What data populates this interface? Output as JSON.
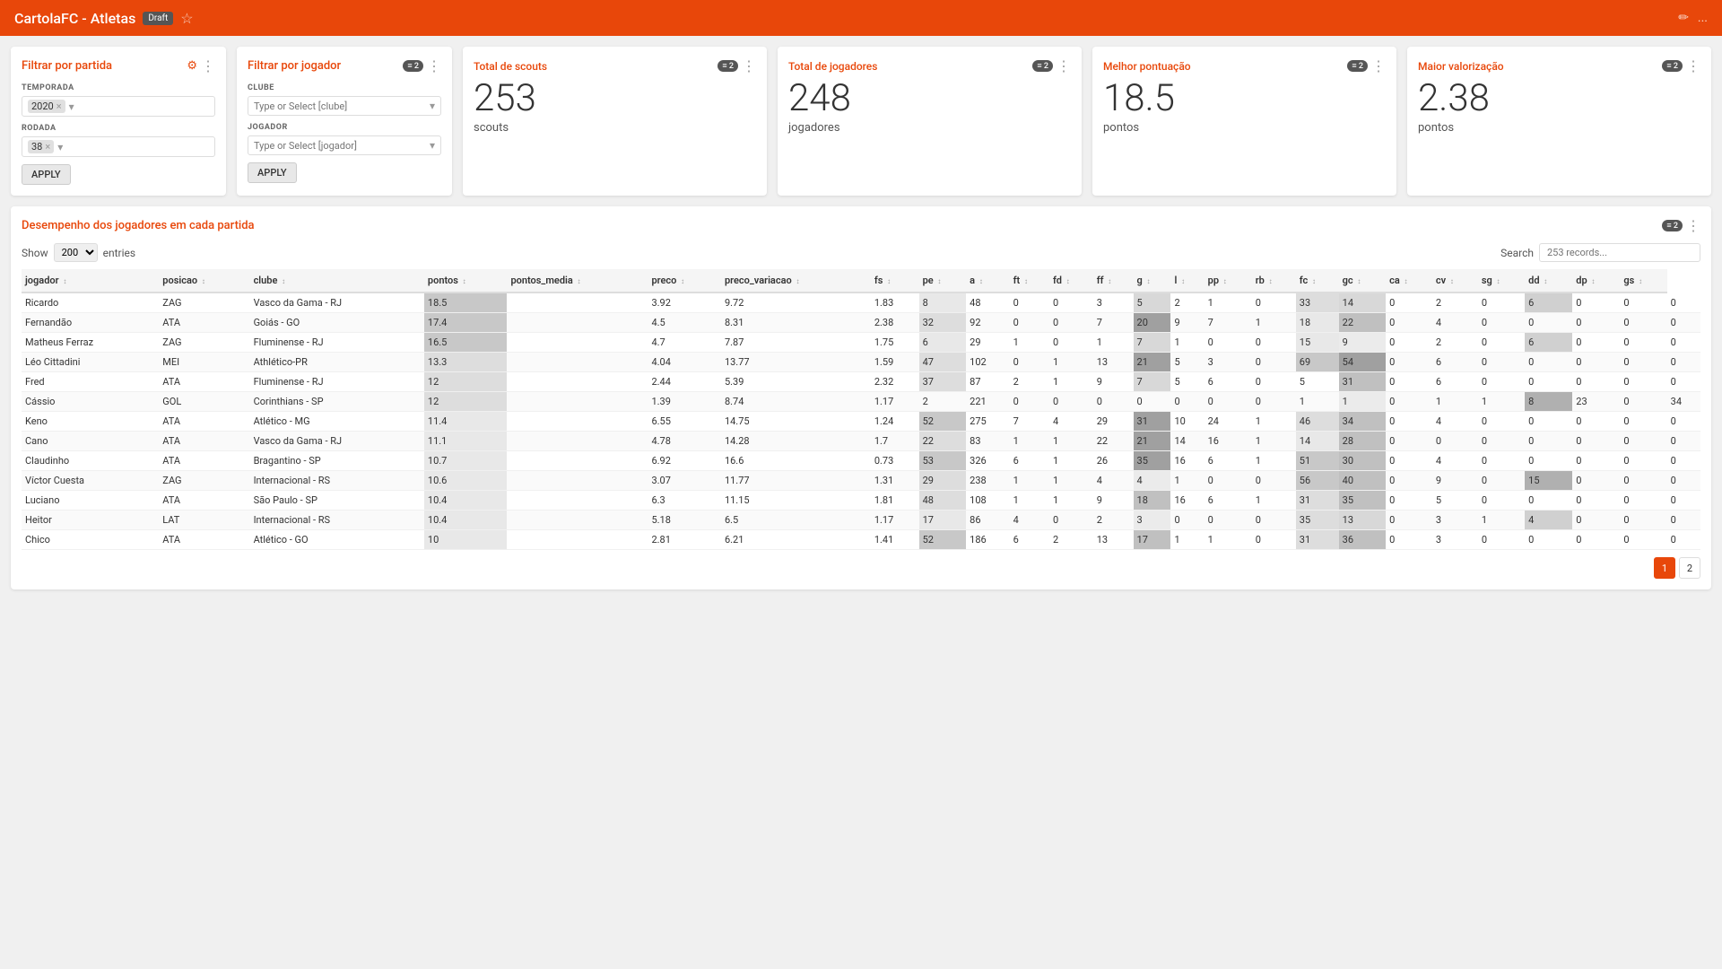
{
  "header": {
    "title": "CartolaFC - Atletas",
    "draft_label": "Draft",
    "edit_icon": "✏",
    "more_icon": "..."
  },
  "filter_partida": {
    "title": "Filtrar por partida",
    "temporada_label": "TEMPORADA",
    "temporada_value": "2020",
    "rodada_label": "RODADA",
    "rodada_value": "38",
    "apply_label": "APPLY"
  },
  "filter_jogador": {
    "title": "Filtrar por jogador",
    "clube_label": "CLUBE",
    "clube_placeholder": "Type or Select [clube]",
    "jogador_label": "JOGADOR",
    "jogador_placeholder": "Type or Select [jogador]",
    "apply_label": "APPLY"
  },
  "metrics": {
    "scouts": {
      "title": "Total de scouts",
      "value": "253",
      "unit": "scouts"
    },
    "jogadores": {
      "title": "Total de jogadores",
      "value": "248",
      "unit": "jogadores"
    },
    "melhor_pontuacao": {
      "title": "Melhor pontuação",
      "value": "18.5",
      "unit": "pontos"
    },
    "maior_valorizacao": {
      "title": "Maior valorização",
      "value": "2.38",
      "unit": "pontos"
    }
  },
  "table_section": {
    "title": "Desempenho dos jogadores em cada partida",
    "show_label": "Show",
    "entries_label": "entries",
    "entries_value": "200",
    "search_label": "Search",
    "search_placeholder": "253 records...",
    "columns": [
      "jogador",
      "posicao",
      "clube",
      "pontos",
      "pontos_media",
      "preco",
      "preco_variacao",
      "fs",
      "pe",
      "a",
      "ft",
      "fd",
      "ff",
      "g",
      "l",
      "pp",
      "rb",
      "fc",
      "gc",
      "ca",
      "cv",
      "sg",
      "dd",
      "dp",
      "gs"
    ],
    "rows": [
      [
        "Ricardo",
        "ZAG",
        "Vasco da Gama - RJ",
        "18.5",
        "",
        "3.92",
        "9.72",
        "1.83",
        "8",
        "48",
        "0",
        "0",
        "3",
        "5",
        "2",
        "1",
        "0",
        "33",
        "14",
        "0",
        "2",
        "0",
        "6",
        "0",
        "0",
        "0"
      ],
      [
        "Fernandão",
        "ATA",
        "Goiás - GO",
        "17.4",
        "",
        "4.5",
        "8.31",
        "2.38",
        "32",
        "92",
        "0",
        "0",
        "7",
        "20",
        "9",
        "7",
        "1",
        "18",
        "22",
        "0",
        "4",
        "0",
        "0",
        "0",
        "0",
        "0"
      ],
      [
        "Matheus Ferraz",
        "ZAG",
        "Fluminense - RJ",
        "16.5",
        "",
        "4.7",
        "7.87",
        "1.75",
        "6",
        "29",
        "1",
        "0",
        "1",
        "7",
        "1",
        "0",
        "0",
        "15",
        "9",
        "0",
        "2",
        "0",
        "6",
        "0",
        "0",
        "0"
      ],
      [
        "Léo Cittadini",
        "MEI",
        "Athlético-PR",
        "13.3",
        "",
        "4.04",
        "13.77",
        "1.59",
        "47",
        "102",
        "0",
        "1",
        "13",
        "21",
        "5",
        "3",
        "0",
        "69",
        "54",
        "0",
        "6",
        "0",
        "0",
        "0",
        "0",
        "0"
      ],
      [
        "Fred",
        "ATA",
        "Fluminense - RJ",
        "12",
        "",
        "2.44",
        "5.39",
        "2.32",
        "37",
        "87",
        "2",
        "1",
        "9",
        "7",
        "5",
        "6",
        "0",
        "5",
        "31",
        "0",
        "6",
        "0",
        "0",
        "0",
        "0",
        "0"
      ],
      [
        "Cássio",
        "GOL",
        "Corinthians - SP",
        "12",
        "",
        "1.39",
        "8.74",
        "1.17",
        "2",
        "221",
        "0",
        "0",
        "0",
        "0",
        "0",
        "0",
        "0",
        "1",
        "1",
        "0",
        "1",
        "1",
        "8",
        "23",
        "0",
        "34"
      ],
      [
        "Keno",
        "ATA",
        "Atlético - MG",
        "11.4",
        "",
        "6.55",
        "14.75",
        "1.24",
        "52",
        "275",
        "7",
        "4",
        "29",
        "31",
        "10",
        "24",
        "1",
        "46",
        "34",
        "0",
        "4",
        "0",
        "0",
        "0",
        "0",
        "0"
      ],
      [
        "Cano",
        "ATA",
        "Vasco da Gama - RJ",
        "11.1",
        "",
        "4.78",
        "14.28",
        "1.7",
        "22",
        "83",
        "1",
        "1",
        "22",
        "21",
        "14",
        "16",
        "1",
        "14",
        "28",
        "0",
        "0",
        "0",
        "0",
        "0",
        "0",
        "0"
      ],
      [
        "Claudinho",
        "ATA",
        "Bragantino - SP",
        "10.7",
        "",
        "6.92",
        "16.6",
        "0.73",
        "53",
        "326",
        "6",
        "1",
        "26",
        "35",
        "16",
        "6",
        "1",
        "51",
        "30",
        "0",
        "4",
        "0",
        "0",
        "0",
        "0",
        "0"
      ],
      [
        "Víctor Cuesta",
        "ZAG",
        "Internacional - RS",
        "10.6",
        "",
        "3.07",
        "11.77",
        "1.31",
        "29",
        "238",
        "1",
        "1",
        "4",
        "4",
        "1",
        "0",
        "0",
        "56",
        "40",
        "0",
        "9",
        "0",
        "15",
        "0",
        "0",
        "0"
      ],
      [
        "Luciano",
        "ATA",
        "São Paulo - SP",
        "10.4",
        "",
        "6.3",
        "11.15",
        "1.81",
        "48",
        "108",
        "1",
        "1",
        "9",
        "18",
        "16",
        "6",
        "1",
        "31",
        "35",
        "0",
        "5",
        "0",
        "0",
        "0",
        "0",
        "0"
      ],
      [
        "Heitor",
        "LAT",
        "Internacional - RS",
        "10.4",
        "",
        "5.18",
        "6.5",
        "1.17",
        "17",
        "86",
        "4",
        "0",
        "2",
        "3",
        "0",
        "0",
        "0",
        "35",
        "13",
        "0",
        "3",
        "1",
        "4",
        "0",
        "0",
        "0"
      ],
      [
        "Chico",
        "ATA",
        "Atlético - GO",
        "10",
        "",
        "2.81",
        "6.21",
        "1.41",
        "52",
        "186",
        "6",
        "2",
        "13",
        "17",
        "1",
        "1",
        "0",
        "31",
        "36",
        "0",
        "3",
        "0",
        "0",
        "0",
        "0",
        "0"
      ]
    ],
    "pagination": [
      "1",
      "2"
    ]
  }
}
